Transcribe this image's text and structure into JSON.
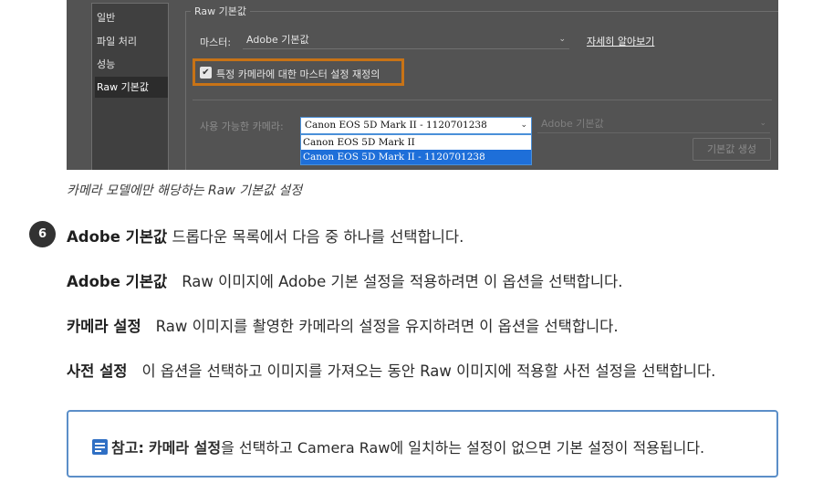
{
  "dialog": {
    "categories": [
      {
        "label": "일반"
      },
      {
        "label": "파일 처리"
      },
      {
        "label": "성능"
      },
      {
        "label": "Raw 기본값",
        "selected": true
      }
    ],
    "group_title": "Raw 기본값",
    "master_label": "마스터:",
    "master_value": "Adobe 기본값",
    "learn_more": "자세히 알아보기",
    "override_checkbox": {
      "label": "특정 카메라에 대한 마스터 설정 재정의",
      "checked": true
    },
    "camera_label": "사용 가능한 카메라:",
    "camera_selected": "Canon EOS 5D Mark II - 1120701238",
    "camera_options": [
      "Canon EOS 5D Mark II",
      "Canon EOS 5D Mark II - 1120701238"
    ],
    "camera_default_value": "Adobe 기본값",
    "create_default_button": "기본값 생성",
    "colors": {
      "highlight": "#c87316",
      "panel": "#535353",
      "selection": "#1e6fd9"
    }
  },
  "caption": "카메라 모델에만 해당하는 Raw 기본값 설정",
  "step": {
    "number": "6",
    "term": "Adobe 기본값",
    "text": " 드롭다운 목록에서 다음 중 하나를 선택합니다."
  },
  "options": [
    {
      "term": "Adobe 기본값",
      "desc": "Raw 이미지에 Adobe 기본 설정을 적용하려면 이 옵션을 선택합니다."
    },
    {
      "term": "카메라 설정",
      "desc": "Raw 이미지를 촬영한 카메라의 설정을 유지하려면 이 옵션을 선택합니다."
    },
    {
      "term": "사전 설정",
      "desc": "이 옵션을 선택하고 이미지를 가져오는 동안 Raw 이미지에 적용할 사전 설정을 선택합니다."
    }
  ],
  "note": {
    "icon": "note-icon",
    "label": "참고:",
    "term": "카메라 설정",
    "text": "을 선택하고 Camera Raw에 일치하는 설정이 없으면 기본 설정이 적용됩니다.",
    "border_color": "#5b8ec8"
  }
}
